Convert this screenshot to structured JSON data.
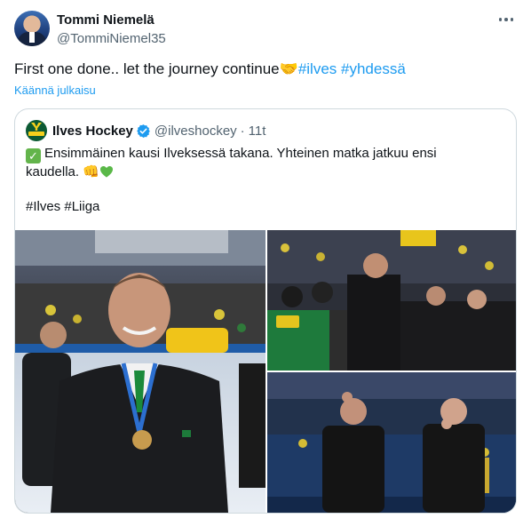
{
  "tweet": {
    "author_name": "Tommi Niemelä",
    "author_handle": "@TommiNiemel35",
    "text": "First one done.. let the journey continue",
    "handshake_emoji": "🤝",
    "hashtags": [
      "#ilves",
      "#yhdessä"
    ],
    "translate_label": "Käännä julkaisu"
  },
  "quote": {
    "name": "Ilves Hockey",
    "handle": "@ilveshockey",
    "separator": "·",
    "time": "11t",
    "line1": "Ensimmäinen kausi Ilveksessä takana. Yhteinen matka jatkuu ensi",
    "line2": "kaudella.",
    "fist_emoji": "👊",
    "tags": "#Ilves #Liiga"
  },
  "icons": {
    "more": "more-horizontal-icon",
    "verified": "verified-badge-icon",
    "check": "check-mark-emoji",
    "heart": "green-heart-emoji"
  },
  "colors": {
    "link": "#1d9bf0",
    "verified": "#1d9bf0",
    "muted": "#536471",
    "border": "#cfd9de",
    "ilves_green": "#0c5a34",
    "ilves_yellow": "#f5d01c"
  }
}
